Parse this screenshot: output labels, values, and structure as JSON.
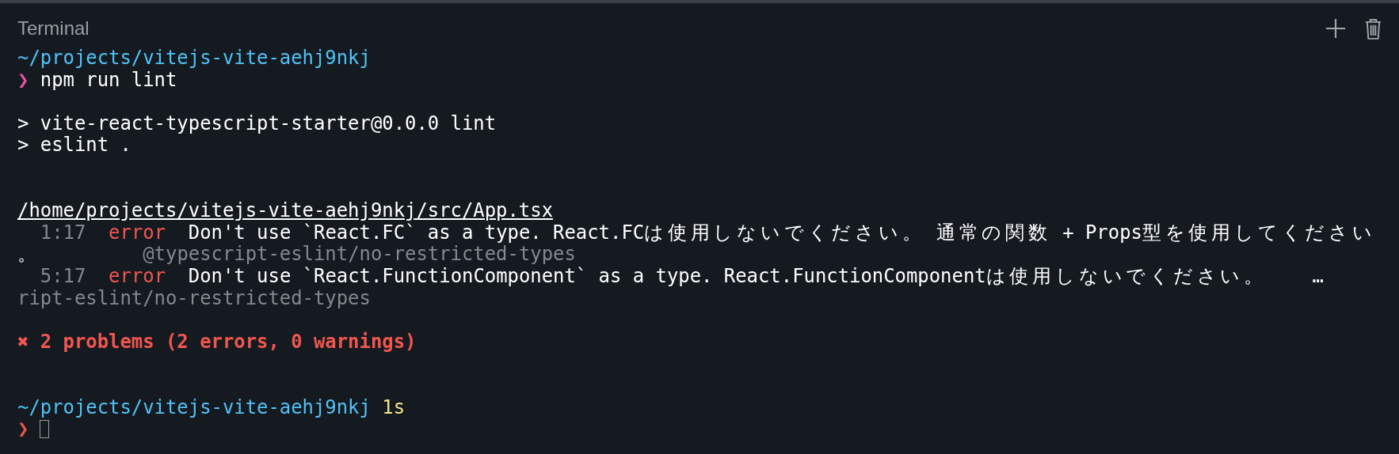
{
  "panel": {
    "title": "Terminal",
    "actions": [
      {
        "kind": "add"
      },
      {
        "kind": "delete"
      }
    ]
  },
  "lines": [
    {
      "kind": "text",
      "segments": [
        {
          "kind": "path",
          "text": "~/projects/vitejs-vite-aehj9nkj"
        }
      ]
    },
    {
      "kind": "text",
      "segments": [
        {
          "kind": "prompt",
          "color": "#e5539f",
          "text": "❯"
        },
        {
          "kind": "command",
          "text": " npm run lint"
        }
      ]
    },
    {
      "kind": "blank"
    },
    {
      "kind": "text",
      "segments": [
        {
          "kind": "plain",
          "text": "> vite-react-typescript-starter@0.0.0 lint"
        }
      ]
    },
    {
      "kind": "text",
      "segments": [
        {
          "kind": "plain",
          "text": "> eslint ."
        }
      ]
    },
    {
      "kind": "blank"
    },
    {
      "kind": "blank"
    },
    {
      "kind": "text",
      "segments": [
        {
          "kind": "file",
          "text": "/home/projects/vitejs-vite-aehj9nkj/src/App.tsx"
        }
      ]
    },
    {
      "kind": "text",
      "segments": [
        {
          "kind": "dim",
          "text": "  1:17"
        },
        {
          "kind": "error",
          "text": "  error"
        },
        {
          "kind": "plain",
          "text": "  Don't use `React.FC` as a type. React.FCは使用しないでください。 通常の関数 + Props型を使用してください"
        }
      ]
    },
    {
      "kind": "text",
      "segments": [
        {
          "kind": "plain",
          "text": "。"
        },
        {
          "kind": "dim",
          "text": "         @typescript-eslint/no-restricted-types"
        }
      ]
    },
    {
      "kind": "text",
      "segments": [
        {
          "kind": "dim",
          "text": "  5:17"
        },
        {
          "kind": "error",
          "text": "  error"
        },
        {
          "kind": "plain",
          "text": "  Don't use `React.FunctionComponent` as a type. React.FunctionComponentは使用しないでください。    …"
        }
      ]
    },
    {
      "kind": "text",
      "segments": [
        {
          "kind": "dim",
          "text": "ript-eslint/no-restricted-types"
        }
      ]
    },
    {
      "kind": "blank"
    },
    {
      "kind": "text",
      "segments": [
        {
          "kind": "summary",
          "text": "✖ 2 problems (2 errors, 0 warnings)"
        }
      ]
    },
    {
      "kind": "blank"
    },
    {
      "kind": "blank"
    },
    {
      "kind": "text",
      "segments": [
        {
          "kind": "path",
          "text": "~/projects/vitejs-vite-aehj9nkj"
        },
        {
          "kind": "duration",
          "text": " 1s"
        }
      ]
    },
    {
      "kind": "text",
      "segments": [
        {
          "kind": "prompt",
          "color": "#f0544c",
          "text": "❯"
        },
        {
          "kind": "cursor"
        }
      ]
    }
  ]
}
